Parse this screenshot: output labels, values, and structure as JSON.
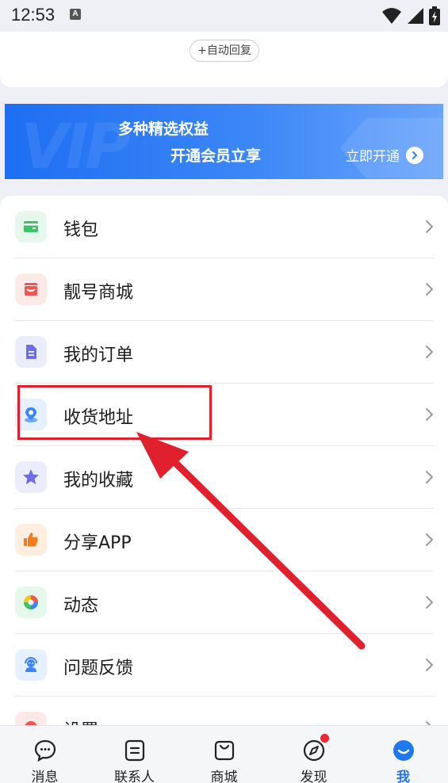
{
  "status_bar": {
    "time": "12:53",
    "notification_badge": "A"
  },
  "auto_reply": {
    "label": "+自动回复"
  },
  "vip_banner": {
    "watermark": "VIP",
    "line1": "多种精选权益",
    "line2": "开通会员立享",
    "cta_label": "立即开通"
  },
  "menu": {
    "items": [
      {
        "label": "钱包",
        "icon": "wallet-icon",
        "color": "#3dc46a",
        "bg": "#e6f7ec"
      },
      {
        "label": "靓号商城",
        "icon": "store-icon",
        "color": "#f2544f",
        "bg": "#fde9e8"
      },
      {
        "label": "我的订单",
        "icon": "order-doc-icon",
        "color": "#6b6ee8",
        "bg": "#ecedfc"
      },
      {
        "label": "收货地址",
        "icon": "location-icon",
        "color": "#3b86f7",
        "bg": "#e7f0fe"
      },
      {
        "label": "我的收藏",
        "icon": "star-icon",
        "color": "#6b6ee8",
        "bg": "#ecedfc"
      },
      {
        "label": "分享APP",
        "icon": "thumbs-up-icon",
        "color": "#f27c1e",
        "bg": "#fdeedf"
      },
      {
        "label": "动态",
        "icon": "aperture-icon",
        "color": "#3dc46a",
        "bg": "#e6f7ec"
      },
      {
        "label": "问题反馈",
        "icon": "customer-service-icon",
        "color": "#3b86f7",
        "bg": "#e7f0fe"
      },
      {
        "label": "设置",
        "icon": "gear-icon",
        "color": "#f2544f",
        "bg": "#fde9e8"
      }
    ]
  },
  "tabs": [
    {
      "label": "消息",
      "icon": "chat-icon",
      "active": false
    },
    {
      "label": "联系人",
      "icon": "contacts-icon",
      "active": false
    },
    {
      "label": "商城",
      "icon": "shopping-bag-icon",
      "active": false
    },
    {
      "label": "发现",
      "icon": "compass-icon",
      "active": false,
      "badge": true
    },
    {
      "label": "我",
      "icon": "profile-icon",
      "active": true
    }
  ],
  "colors": {
    "accent": "#1e78f0",
    "annotation": "#e0202c",
    "background": "#eef0f5"
  }
}
